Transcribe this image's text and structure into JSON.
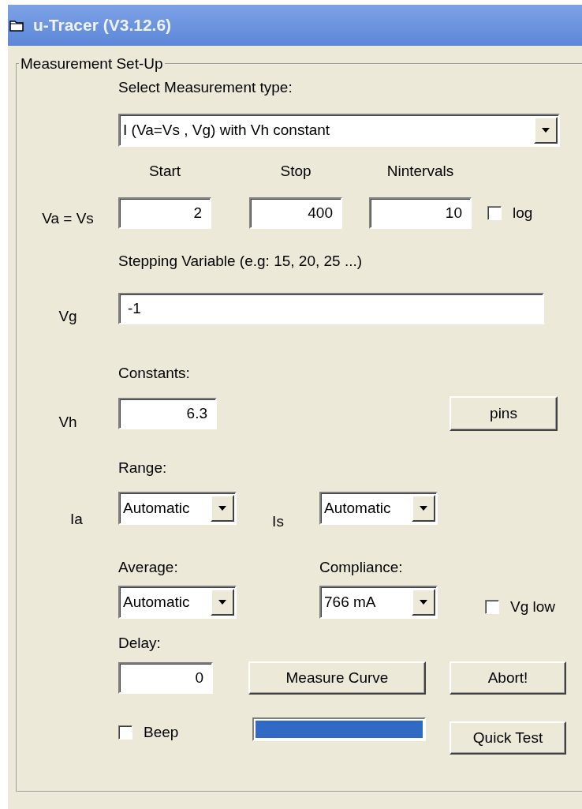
{
  "window": {
    "title": "u-Tracer (V3.12.6)"
  },
  "group": {
    "title": "Measurement Set-Up"
  },
  "measurement_type": {
    "label": "Select Measurement type:",
    "value": "I (Va=Vs , Vg) with Vh constant"
  },
  "sweep": {
    "label": "Va = Vs",
    "columns": [
      "Start",
      "Stop",
      "Nintervals"
    ],
    "values": [
      "2",
      "400",
      "10"
    ],
    "log": {
      "label": "log",
      "checked": false
    }
  },
  "stepping": {
    "label": "Stepping Variable (e.g: 15, 20, 25 ...)",
    "variable": "Vg",
    "value": "-1"
  },
  "constants": {
    "label": "Constants:",
    "variable": "Vh",
    "value": "6.3",
    "pins_button": "pins"
  },
  "range": {
    "label": "Range:",
    "ia": {
      "label": "Ia",
      "value": "Automatic"
    },
    "is": {
      "label": "Is",
      "value": "Automatic"
    }
  },
  "average": {
    "label": "Average:",
    "value": "Automatic"
  },
  "compliance": {
    "label": "Compliance:",
    "value": "766 mA"
  },
  "vg_low": {
    "label": "Vg low",
    "checked": false
  },
  "delay": {
    "label": "Delay:",
    "value": "0"
  },
  "buttons": {
    "measure": "Measure Curve",
    "abort": "Abort!",
    "quick_test": "Quick Test"
  },
  "beep": {
    "label": "Beep",
    "checked": false
  },
  "progress": {
    "level": 1
  }
}
